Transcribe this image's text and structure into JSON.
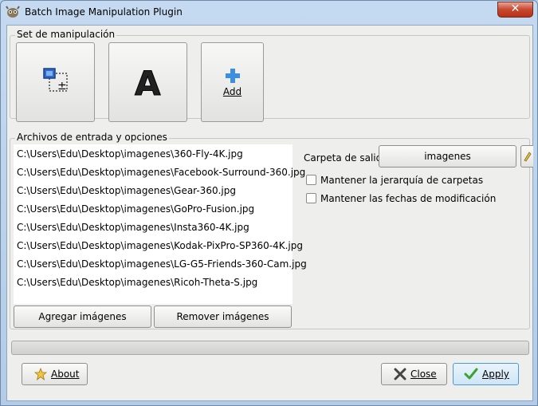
{
  "window": {
    "title": "Batch Image Manipulation Plugin",
    "close_glyph": "✕"
  },
  "manipulation_set": {
    "label": "Set de manipulación",
    "tools": [
      {
        "icon": "resize-icon"
      },
      {
        "icon": "text-watermark-icon"
      },
      {
        "icon": "add-plus-icon",
        "label": "Add"
      }
    ]
  },
  "files": {
    "label": "Archivos de entrada y opciones",
    "items": [
      "C:\\Users\\Edu\\Desktop\\imagenes\\360-Fly-4K.jpg",
      "C:\\Users\\Edu\\Desktop\\imagenes\\Facebook-Surround-360.jpg",
      "C:\\Users\\Edu\\Desktop\\imagenes\\Gear-360.jpg",
      "C:\\Users\\Edu\\Desktop\\imagenes\\GoPro-Fusion.jpg",
      "C:\\Users\\Edu\\Desktop\\imagenes\\Insta360-4K.jpg",
      "C:\\Users\\Edu\\Desktop\\imagenes\\Kodak-PixPro-SP360-4K.jpg",
      "C:\\Users\\Edu\\Desktop\\imagenes\\LG-G5-Friends-360-Cam.jpg",
      "C:\\Users\\Edu\\Desktop\\imagenes\\Ricoh-Theta-S.jpg"
    ],
    "add_button": "Agregar imágenes",
    "remove_button": "Remover imágenes"
  },
  "output": {
    "folder_label": "Carpeta de salida",
    "folder_value": "imagenes",
    "keep_hierarchy_label": "Mantener la jerarquía de carpetas",
    "keep_hierarchy_checked": false,
    "keep_dates_label": "Mantener las fechas de modificación",
    "keep_dates_checked": false
  },
  "progress": {
    "value": 0
  },
  "footer": {
    "about_label": "About",
    "close_label": "Close",
    "apply_label": "Apply"
  },
  "colors": {
    "accent": "#2d6ac9",
    "apply_border": "#4a9ad8"
  }
}
